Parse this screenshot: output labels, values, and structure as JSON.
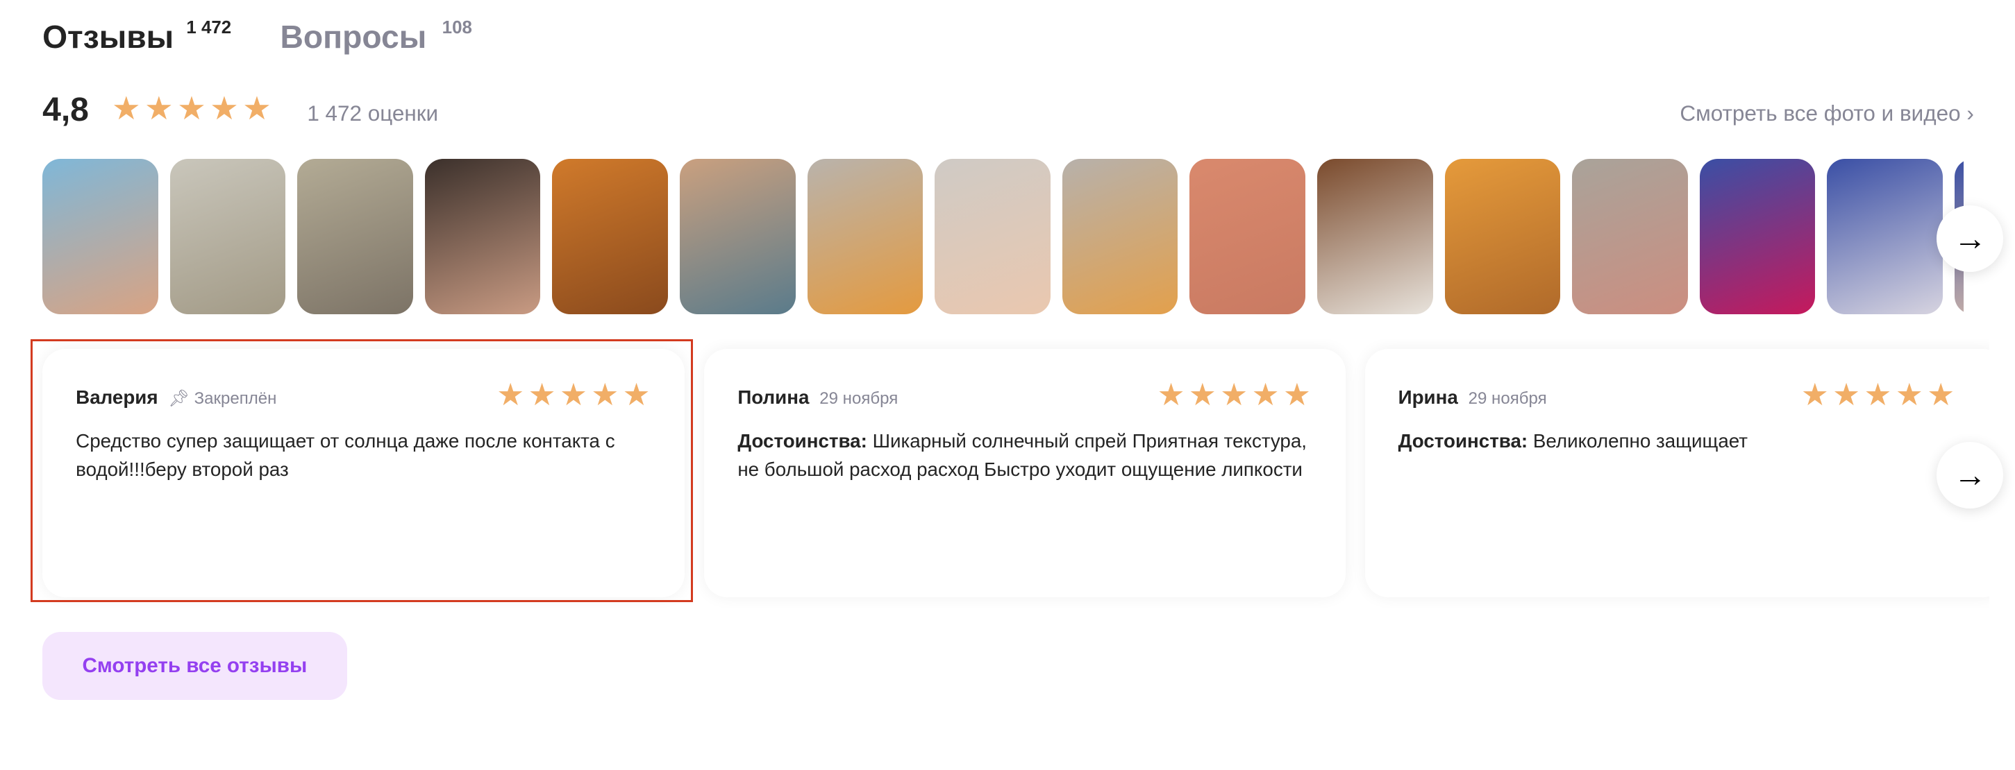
{
  "tabs": [
    {
      "label": "Отзывы",
      "count": "1 472",
      "active": true
    },
    {
      "label": "Вопросы",
      "count": "108",
      "active": false
    }
  ],
  "summary": {
    "rating": "4,8",
    "stars": 4.8,
    "ratings_count": "1 472 оценки",
    "all_media_link": "Смотреть все фото и видео"
  },
  "colors": {
    "star": "#f1ae67",
    "accent": "#9440f0",
    "muted": "#868695",
    "selection": "#d33b20"
  },
  "thumbnails": [
    {
      "colors": [
        "#7fb7d8",
        "#d9a383"
      ]
    },
    {
      "colors": [
        "#c9c6bb",
        "#a29a86"
      ]
    },
    {
      "colors": [
        "#b3ab95",
        "#7c7366"
      ]
    },
    {
      "colors": [
        "#3b302b",
        "#c99b83"
      ]
    },
    {
      "colors": [
        "#d07a2b",
        "#8a4a1d"
      ]
    },
    {
      "colors": [
        "#caa07f",
        "#5a7b8b"
      ]
    },
    {
      "colors": [
        "#b9b3ac",
        "#e49a3f"
      ]
    },
    {
      "colors": [
        "#cfcac5",
        "#eac8af"
      ]
    },
    {
      "colors": [
        "#b7b1ab",
        "#e3a04c"
      ]
    },
    {
      "colors": [
        "#d9896d",
        "#c97a62"
      ]
    },
    {
      "colors": [
        "#7a4a2c",
        "#e8e3dc"
      ]
    },
    {
      "colors": [
        "#e59a3b",
        "#b06a2a"
      ]
    },
    {
      "colors": [
        "#a9a39a",
        "#cc8e80"
      ]
    },
    {
      "colors": [
        "#3a4fa5",
        "#c6195c"
      ]
    },
    {
      "colors": [
        "#3a4fa5",
        "#d7d4e0"
      ]
    }
  ],
  "reviews": [
    {
      "author": "Валерия",
      "meta": "Закреплён",
      "pinned": true,
      "stars": 5,
      "label": "",
      "text": "Средство супер защищает от солнца даже после контакта с водой!!!беру второй раз"
    },
    {
      "author": "Полина",
      "meta": "29 ноября",
      "pinned": false,
      "stars": 5,
      "label": "Достоинства:",
      "text": "Шикарный солнечный спрей Приятная текстура, не большой расход расход Быстро уходит ощущение липкости"
    },
    {
      "author": "Ирина",
      "meta": "29 ноября",
      "pinned": false,
      "stars": 5,
      "label": "Достоинства:",
      "text": "Великолепно защищает"
    }
  ],
  "all_reviews_button": "Смотреть все отзывы"
}
